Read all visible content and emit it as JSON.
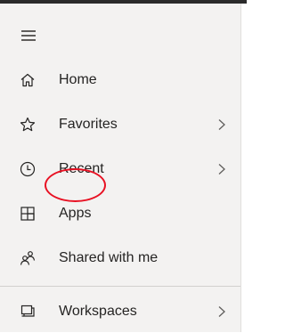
{
  "nav": {
    "menu_icon": "hamburger-menu-icon",
    "items": [
      {
        "label": "Home",
        "icon": "home-icon",
        "has_chevron": false
      },
      {
        "label": "Favorites",
        "icon": "star-icon",
        "has_chevron": true
      },
      {
        "label": "Recent",
        "icon": "clock-icon",
        "has_chevron": true
      },
      {
        "label": "Apps",
        "icon": "apps-icon",
        "has_chevron": false,
        "highlighted": true
      },
      {
        "label": "Shared with me",
        "icon": "shared-people-icon",
        "has_chevron": false
      },
      {
        "label": "Workspaces",
        "icon": "workspaces-icon",
        "has_chevron": true
      }
    ]
  },
  "annotation": {
    "color": "#e81123",
    "target": "Apps"
  }
}
